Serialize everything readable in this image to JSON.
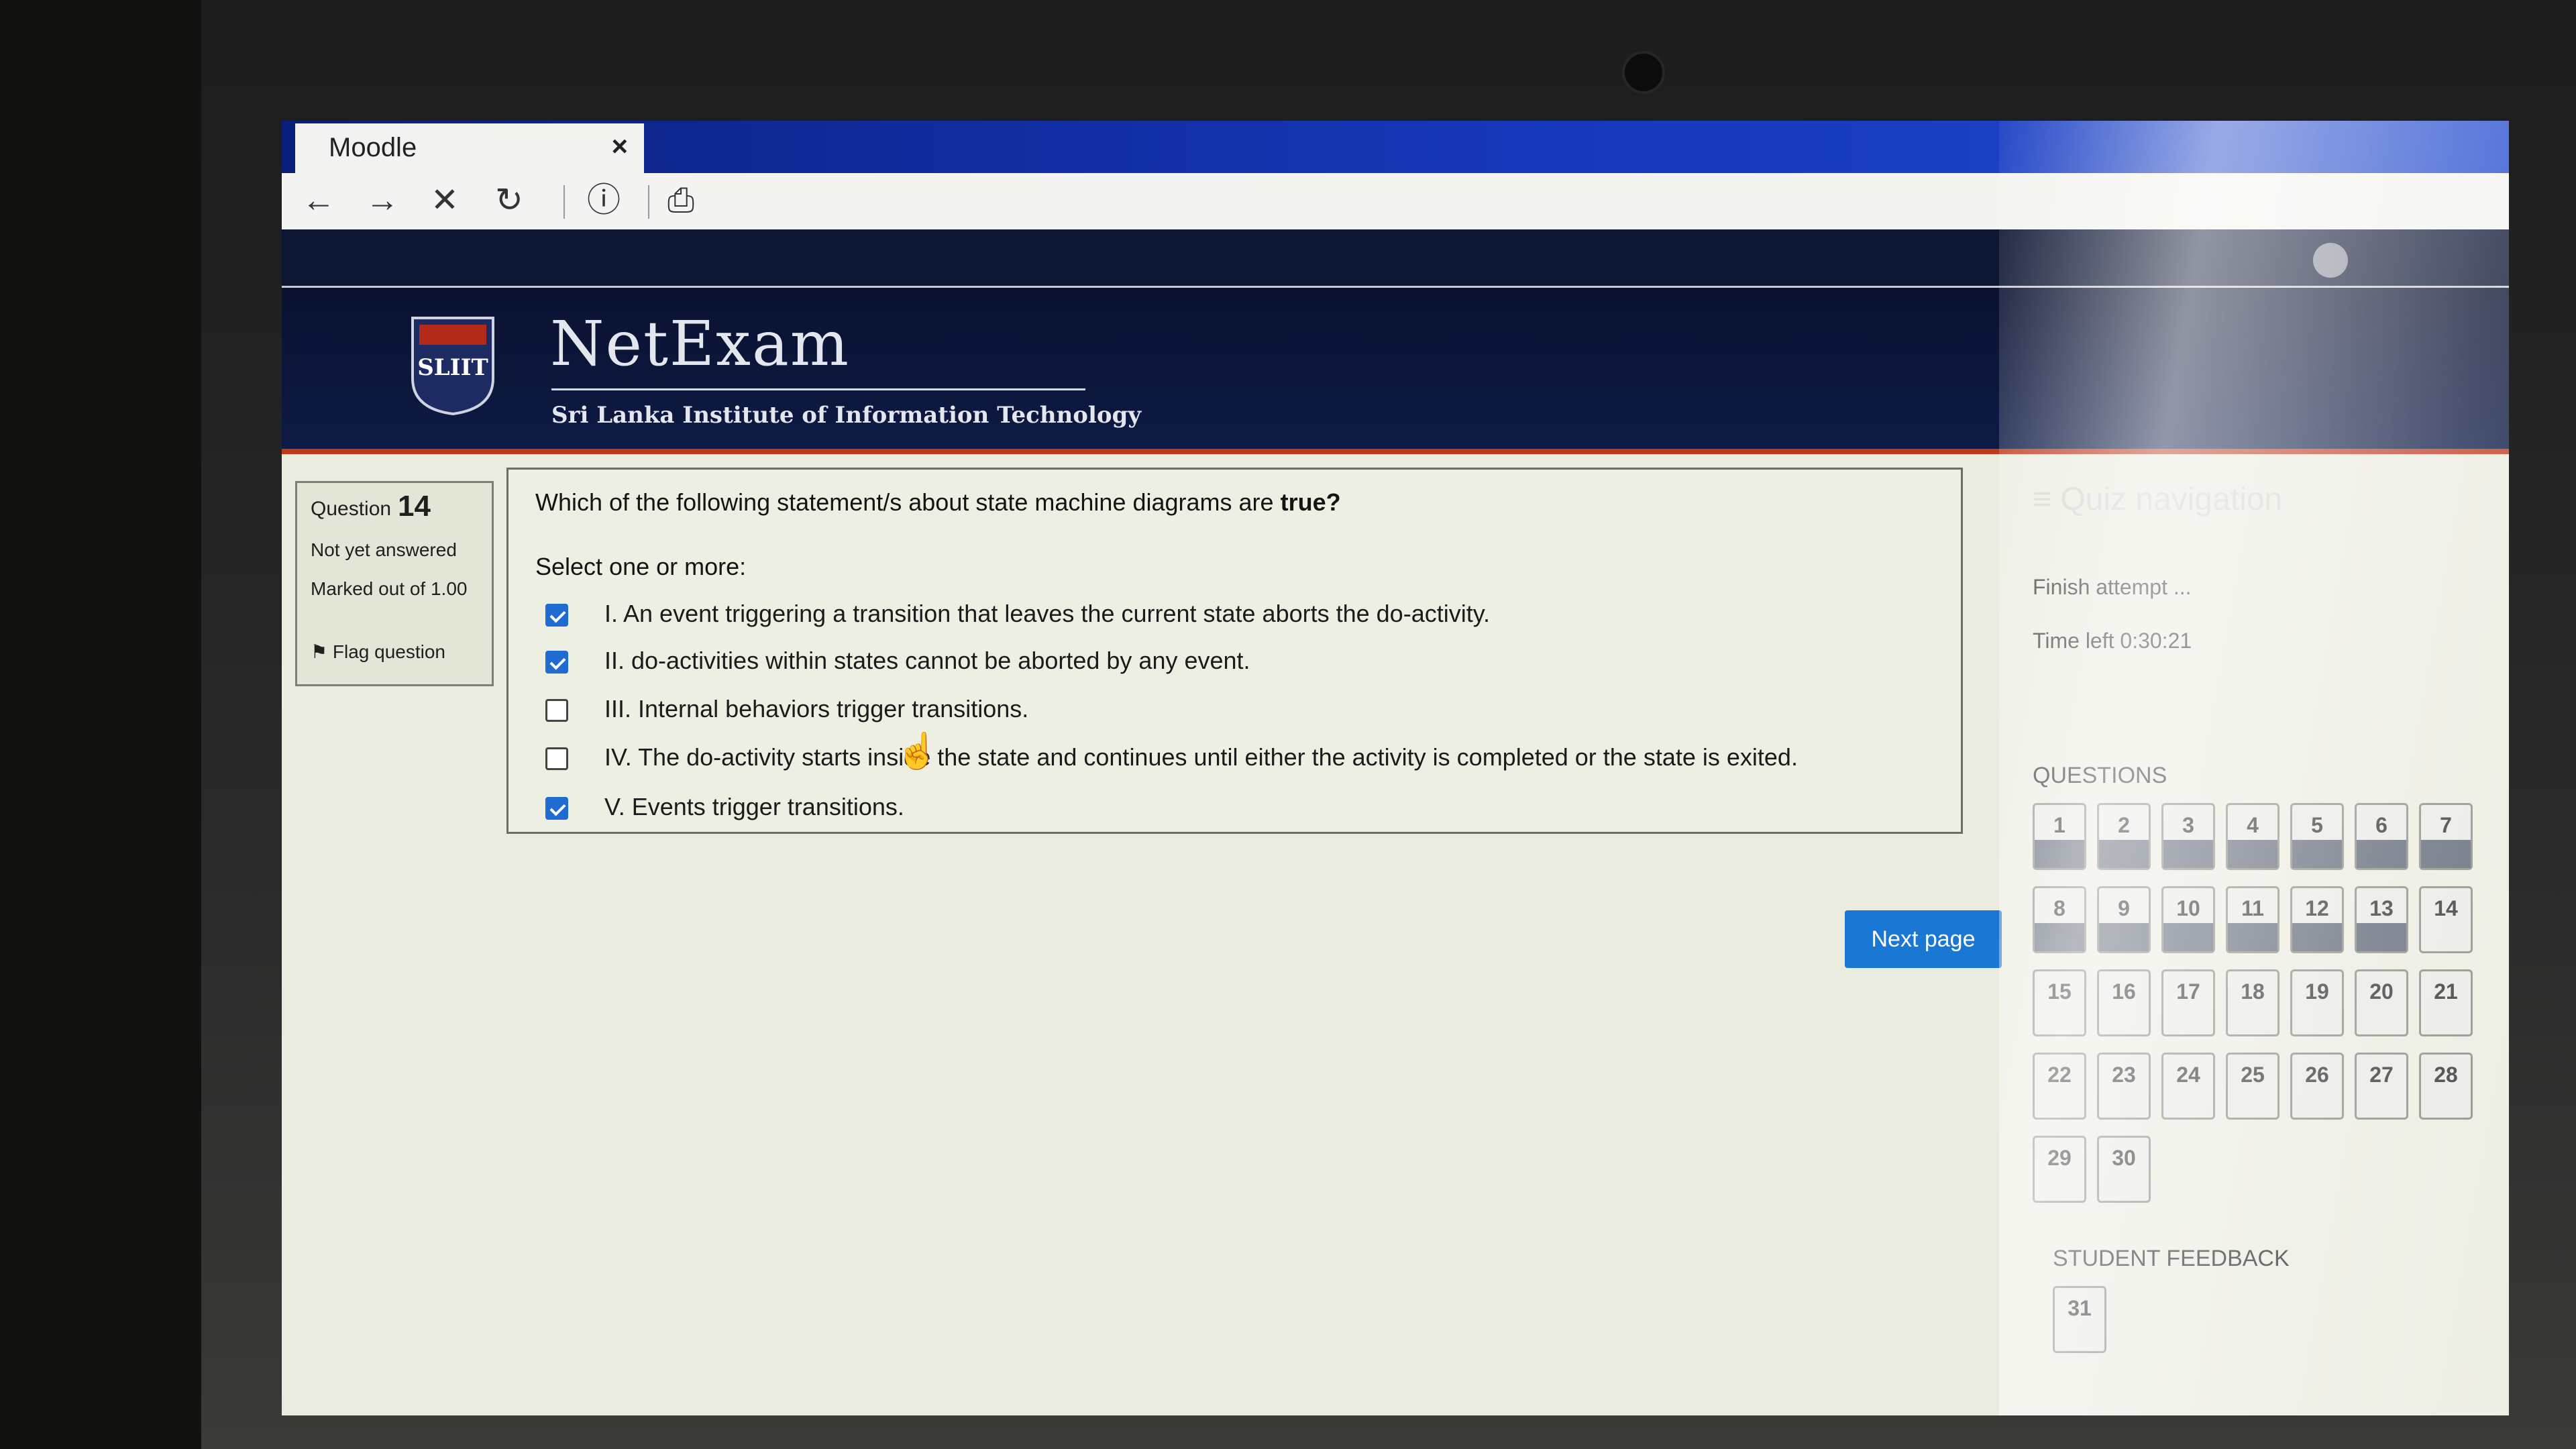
{
  "browser": {
    "tab_title": "Moodle",
    "tab_close": "×",
    "toolbar": {
      "back": "←",
      "forward": "→",
      "stop": "✕",
      "reload": "↻",
      "info": "ⓘ",
      "page": "⎙"
    }
  },
  "header": {
    "brand": "NetExam",
    "subtitle": "Sri Lanka Institute of Information Technology",
    "logo_text": "SLIIT"
  },
  "question_info": {
    "label": "Question",
    "number": "14",
    "state": "Not yet answered",
    "marked": "Marked out of 1.00",
    "flag": "Flag question"
  },
  "question": {
    "text_prefix": "Which of the following statement/s about state machine diagrams are ",
    "text_bold": "true?",
    "select_hint": "Select one or more:",
    "options": [
      {
        "label": "I. An event triggering a transition that leaves the current state aborts the do-activity.",
        "checked": true
      },
      {
        "label": "II. do-activities within states cannot be aborted by any event.",
        "checked": true
      },
      {
        "label": "III. Internal behaviors trigger transitions.",
        "checked": false
      },
      {
        "label": "IV. The do-activity starts inside the state and continues until either the activity is completed or the state is exited.",
        "checked": false
      },
      {
        "label": "V. Events trigger transitions.",
        "checked": true
      }
    ]
  },
  "next_button": "Next page",
  "quiz_nav": {
    "title": "Quiz navigation",
    "finish": "Finish attempt ...",
    "time_left": "Time left 0:30:21",
    "questions_heading": "QUESTIONS",
    "questions": [
      "1",
      "2",
      "3",
      "4",
      "5",
      "6",
      "7",
      "8",
      "9",
      "10",
      "11",
      "12",
      "13",
      "14",
      "15",
      "16",
      "17",
      "18",
      "19",
      "20",
      "21",
      "22",
      "23",
      "24",
      "25",
      "26",
      "27",
      "28",
      "29",
      "30"
    ],
    "answered": [
      "1",
      "2",
      "3",
      "4",
      "5",
      "6",
      "7",
      "8",
      "9",
      "10",
      "11",
      "12",
      "13"
    ],
    "feedback_heading": "STUDENT FEEDBACK",
    "feedback_questions": [
      "31"
    ]
  },
  "colors": {
    "tab_gradient_start": "#0a1f7c",
    "banner": "#0d1a44",
    "banner_accent": "#c0391b",
    "primary_button": "#1a77d3",
    "checkbox_checked": "#1f6bd1"
  }
}
